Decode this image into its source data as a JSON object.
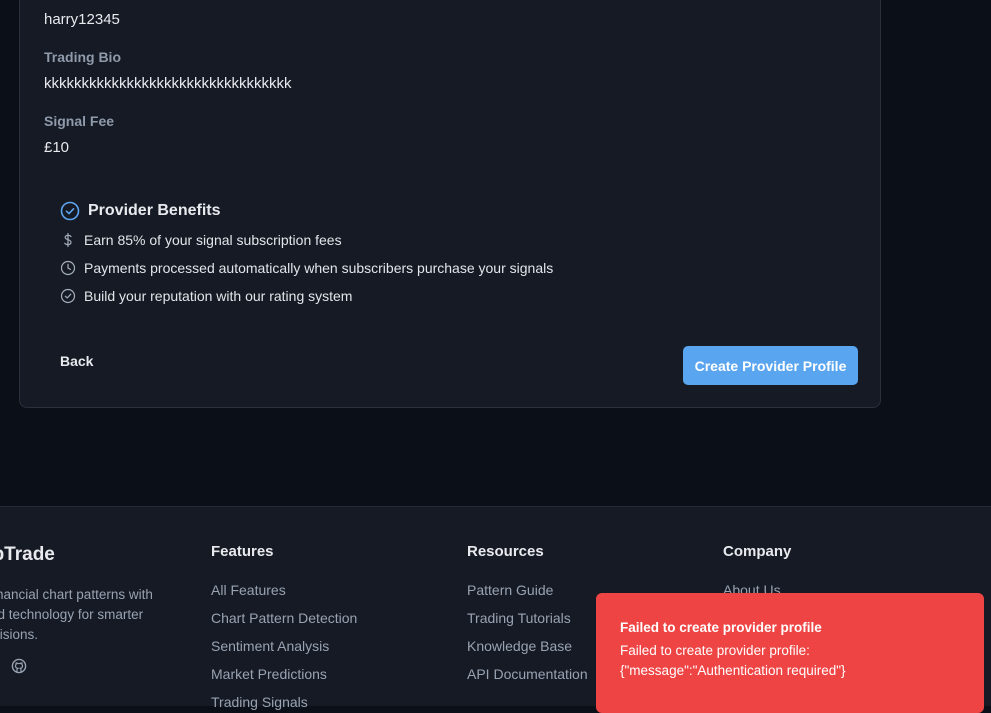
{
  "form": {
    "username_value": "harry12345",
    "bio_label": "Trading Bio",
    "bio_value": "kkkkkkkkkkkkkkkkkkkkkkkkkkkkkkkkk",
    "fee_label": "Signal Fee",
    "fee_value": "£10"
  },
  "benefits": {
    "title": "Provider Benefits",
    "items": [
      {
        "icon": "dollar-icon",
        "text": "Earn 85% of your signal subscription fees"
      },
      {
        "icon": "clock-icon",
        "text": "Payments processed automatically when subscribers purchase your signals"
      },
      {
        "icon": "check-circle-icon",
        "text": "Build your reputation with our rating system"
      }
    ]
  },
  "actions": {
    "back_label": "Back",
    "create_label": "Create Provider Profile"
  },
  "footer": {
    "brand": "apTrade",
    "tagline": "e financial chart patterns with ered technology for smarter decisions.",
    "columns": [
      {
        "title": "Features",
        "links": [
          "All Features",
          "Chart Pattern Detection",
          "Sentiment Analysis",
          "Market Predictions",
          "Trading Signals"
        ]
      },
      {
        "title": "Resources",
        "links": [
          "Pattern Guide",
          "Trading Tutorials",
          "Knowledge Base",
          "API Documentation"
        ]
      },
      {
        "title": "Company",
        "links": [
          "About Us"
        ]
      }
    ]
  },
  "toast": {
    "title": "Failed to create provider profile",
    "message": "Failed to create provider profile: {\"message\":\"Authentication required\"}"
  },
  "colors": {
    "accent": "#5aa5f0",
    "error": "#ef4444",
    "card_bg": "#151a24",
    "page_bg": "#0b0f18"
  }
}
